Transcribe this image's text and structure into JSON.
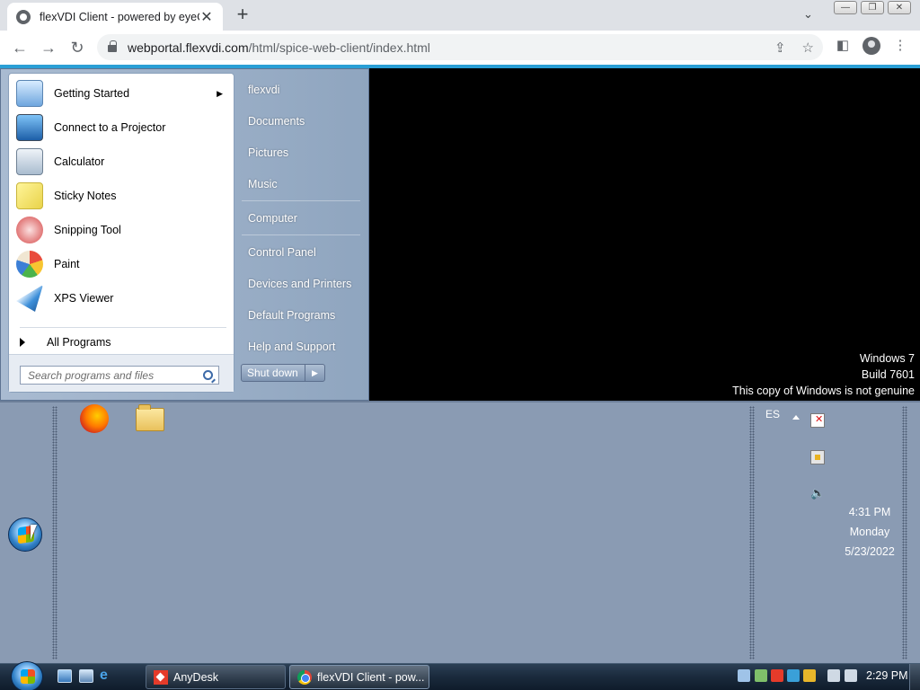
{
  "browser": {
    "tab_title": "flexVDI Client - powered by eyeC",
    "tab_close": "✕",
    "new_tab": "+",
    "tab_search": "⌄",
    "url_domain": "webportal.flexvdi.com",
    "url_path": "/html/spice-web-client/index.html",
    "nav": {
      "back": "←",
      "forward": "→",
      "reload": "↻"
    },
    "window_controls": {
      "minimize": "—",
      "restore": "❐",
      "close": "✕"
    },
    "icons": {
      "share": "⇪",
      "bookmark": "☆",
      "sidepanel": "◧",
      "menu": "⋮"
    },
    "accent_color": "#2a9fd6"
  },
  "start_menu": {
    "pinned": [
      {
        "label": "Getting Started",
        "icon": "getting-started-icon",
        "has_submenu": true
      },
      {
        "label": "Connect to a Projector",
        "icon": "projector-icon"
      },
      {
        "label": "Calculator",
        "icon": "calculator-icon"
      },
      {
        "label": "Sticky Notes",
        "icon": "sticky-notes-icon"
      },
      {
        "label": "Snipping Tool",
        "icon": "scissors-icon"
      },
      {
        "label": "Paint",
        "icon": "paint-palette-icon"
      },
      {
        "label": "XPS Viewer",
        "icon": "xps-viewer-icon"
      }
    ],
    "all_programs": "All Programs",
    "search_placeholder": "Search programs and files",
    "right_items": [
      "flexvdi",
      "Documents",
      "Pictures",
      "Music",
      "Computer",
      "Control Panel",
      "Devices and Printers",
      "Default Programs",
      "Help and Support"
    ],
    "shutdown_label": "Shut down",
    "shutdown_arrow": "▶"
  },
  "watermark": {
    "line1": "Windows 7",
    "line2": "Build 7601",
    "line3": "This copy of Windows is not genuine"
  },
  "remote_tray": {
    "language": "ES",
    "time": "4:31 PM",
    "day": "Monday",
    "date": "5/23/2022",
    "volume_icon": "🔈"
  },
  "host_taskbar": {
    "tasks": [
      {
        "label": "AnyDesk",
        "icon": "anydesk-icon"
      },
      {
        "label": "flexVDI Client - pow...",
        "icon": "chrome-icon"
      }
    ],
    "clock": "2:29 PM"
  }
}
